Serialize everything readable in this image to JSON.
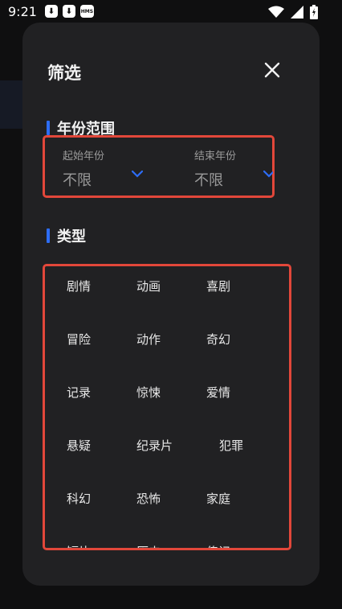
{
  "status_bar": {
    "time": "9:21",
    "hms_label": "HMS"
  },
  "sheet": {
    "title": "筛选",
    "year_section": {
      "heading": "年份范围",
      "start": {
        "label": "起始年份",
        "value": "不限"
      },
      "end": {
        "label": "结束年份",
        "value": "不限"
      }
    },
    "genre_section": {
      "heading": "类型",
      "items": [
        "剧情",
        "动画",
        "喜剧",
        "冒险",
        "动作",
        "奇幻",
        "记录",
        "惊悚",
        "爱情",
        "悬疑",
        "纪录片",
        "犯罪",
        "科幻",
        "恐怖",
        "家庭",
        "短片",
        "历史",
        "传记"
      ]
    }
  },
  "colors": {
    "accent": "#2d6df6",
    "highlight_border": "#e2473a",
    "sheet_bg": "#212123"
  }
}
